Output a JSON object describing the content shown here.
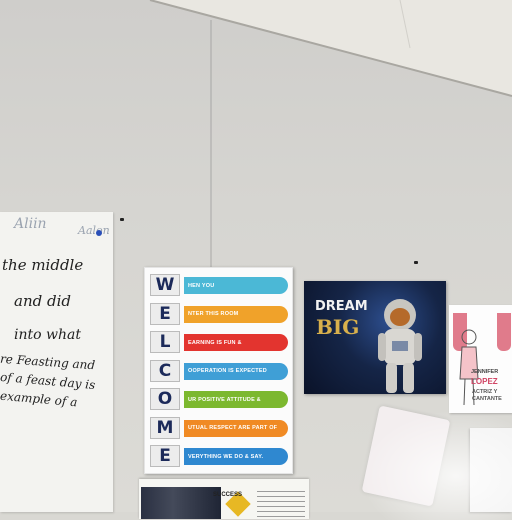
{
  "chart_paper": {
    "header_left": "Aliin",
    "header_right": "Aalon",
    "lines": [
      "the middle",
      "and did",
      "into what",
      "re Feasting and",
      "of a feast day is",
      "example of a"
    ]
  },
  "welcome_poster": {
    "rows": [
      {
        "letter": "W",
        "text": "HEN YOU",
        "color": "#4bb8d6"
      },
      {
        "letter": "E",
        "text": "NTER THIS ROOM",
        "color": "#f0a22a"
      },
      {
        "letter": "L",
        "text": "EARNING IS FUN &",
        "color": "#e3342f"
      },
      {
        "letter": "C",
        "text": "OOPERATION IS EXPECTED",
        "color": "#3f9fd6"
      },
      {
        "letter": "O",
        "text": "UR POSITIVE ATTITUDE &",
        "color": "#7cb82f"
      },
      {
        "letter": "M",
        "text": "UTUAL RESPECT ARE PART OF",
        "color": "#f08a24"
      },
      {
        "letter": "E",
        "text": "VERYTHING WE DO & SAY.",
        "color": "#2f88d0"
      }
    ]
  },
  "dream_poster": {
    "line1": "DREAM",
    "line2": "BIG"
  },
  "coloring_page": {
    "name1": "JENNIFER",
    "name2": "LOPEZ",
    "caption": "ACTRIZ Y CANTANTE"
  },
  "success_paper": {
    "word": "SUCCESS"
  }
}
